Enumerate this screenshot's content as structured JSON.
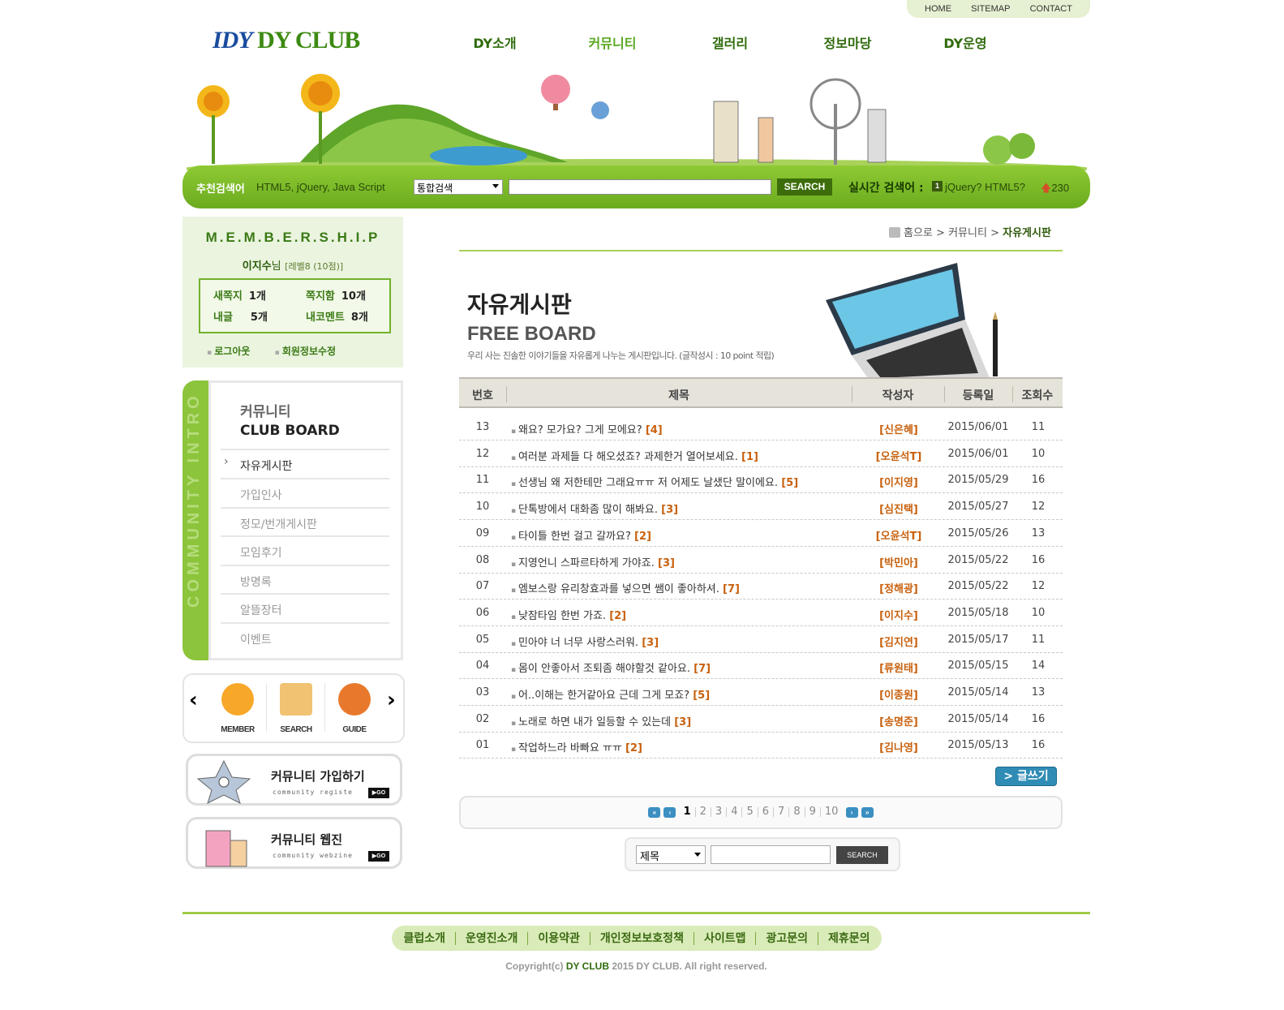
{
  "toplinks": {
    "home": "HOME",
    "sitemap": "SITEMAP",
    "contact": "CONTACT"
  },
  "logo": {
    "part1": "IDY",
    "part2": "DY CLUB"
  },
  "nav": [
    "DY소개",
    "커뮤니티",
    "갤러리",
    "정보마당",
    "DY운영"
  ],
  "search": {
    "rec_label": "추천검색어",
    "rec_words": "HTML5, jQuery, Java Script",
    "select": "통합검색",
    "button": "SEARCH",
    "rt_label": "실시간 검색어 :",
    "rt_rank": "1",
    "rt_word": "jQuery? HTML5?",
    "rt_count": "230"
  },
  "member": {
    "title": "M.E.M.B.E.R.S.H.I.P",
    "name": "이지수",
    "suffix": "님",
    "level": "[레벨8 (10점)]",
    "stats": {
      "new_note_label": "새쪽지",
      "new_note": "1개",
      "note_box_label": "쪽지함",
      "note_box": "10개",
      "my_post_label": "내글",
      "my_post": "5개",
      "my_comment_label": "내코멘트",
      "my_comment": "8개"
    },
    "logout": "로그아웃",
    "edit": "회원정보수정"
  },
  "side": {
    "vertical": "COMMUNITY INTRO",
    "title1": "커뮤니티",
    "title2": "CLUB BOARD",
    "items": [
      "자유게시판",
      "가입인사",
      "정모/번개게시판",
      "모임후기",
      "방명록",
      "알뜰장터",
      "이벤트"
    ]
  },
  "quick": {
    "member": "MEMBER",
    "search": "SEARCH",
    "guide": "GUIDE",
    "prev": "‹",
    "next": "›"
  },
  "banner1": {
    "title": "커뮤니티 가입하기",
    "sub": "community registe",
    "go": "▶GO"
  },
  "banner2": {
    "title": "커뮤니티 웹진",
    "sub": "community webzine",
    "go": "▶GO"
  },
  "breadcrumb": {
    "home": "홈으로",
    "sep1": ">",
    "mid": "커뮤니티",
    "sep2": ">",
    "current": "자유게시판"
  },
  "board": {
    "title_kr": "자유게시판",
    "title_en": "FREE BOARD",
    "desc": "우리 사는 진솔한 이야기들을 자유롭게 나누는 게시판입니다. (글작성시 : 10 point 적립)",
    "headers": {
      "no": "번호",
      "title": "제목",
      "author": "작성자",
      "date": "등록일",
      "hits": "조회수"
    },
    "rows": [
      {
        "no": "13",
        "title": "왜요? 모가요? 그게 모에요?",
        "cnt": "[4]",
        "author": "[신은혜]",
        "date": "2015/06/01",
        "hits": "11"
      },
      {
        "no": "12",
        "title": "여러분 과제들 다 해오셨죠? 과제한거 열어보세요.",
        "cnt": "[1]",
        "author": "[오윤석T]",
        "date": "2015/06/01",
        "hits": "10"
      },
      {
        "no": "11",
        "title": "선생님 왜 저한테만 그래요ㅠㅠ 저 어제도 날샜단 말이에요.",
        "cnt": "[5]",
        "author": "[이지영]",
        "date": "2015/05/29",
        "hits": "16"
      },
      {
        "no": "10",
        "title": "단톡방에서 대화좀 많이 해봐요.",
        "cnt": "[3]",
        "author": "[심진택]",
        "date": "2015/05/27",
        "hits": "12"
      },
      {
        "no": "09",
        "title": "타이틀 한번 걸고 갈까요?",
        "cnt": "[2]",
        "author": "[오윤석T]",
        "date": "2015/05/26",
        "hits": "13"
      },
      {
        "no": "08",
        "title": "지영언니 스파르타하게 가야죠.",
        "cnt": "[3]",
        "author": "[박민아]",
        "date": "2015/05/22",
        "hits": "16"
      },
      {
        "no": "07",
        "title": "엠보스랑 유리창효과를 넣으면 쌤이 좋아하셔.",
        "cnt": "[7]",
        "author": "[정해광]",
        "date": "2015/05/22",
        "hits": "12"
      },
      {
        "no": "06",
        "title": "낮잠타임 한번 가죠.",
        "cnt": "[2]",
        "author": "[이지수]",
        "date": "2015/05/18",
        "hits": "10"
      },
      {
        "no": "05",
        "title": "민아야 너 너무 사랑스러워.",
        "cnt": "[3]",
        "author": "[김지연]",
        "date": "2015/05/17",
        "hits": "11"
      },
      {
        "no": "04",
        "title": "몸이 안좋아서 조퇴좀 해야할것 같아요.",
        "cnt": "[7]",
        "author": "[류원태]",
        "date": "2015/05/15",
        "hits": "14"
      },
      {
        "no": "03",
        "title": "어..이해는 한거같아요 근데 그게 모죠?",
        "cnt": "[5]",
        "author": "[이종원]",
        "date": "2015/05/14",
        "hits": "13"
      },
      {
        "no": "02",
        "title": "노래로 하면 내가 일등할 수 있는데",
        "cnt": "[3]",
        "author": "[송명준]",
        "date": "2015/05/14",
        "hits": "16"
      },
      {
        "no": "01",
        "title": "작업하느라 바빠요 ㅠㅠ",
        "cnt": "[2]",
        "author": "[김나영]",
        "date": "2015/05/13",
        "hits": "16"
      }
    ],
    "write": "> 글쓰기"
  },
  "pager": {
    "first": "«",
    "prev": "‹",
    "next": "›",
    "last": "»",
    "pages": [
      "1",
      "2",
      "3",
      "4",
      "5",
      "6",
      "7",
      "8",
      "9",
      "10"
    ],
    "current": "1"
  },
  "bsearch": {
    "select": "제목",
    "button": "SEARCH"
  },
  "footer": {
    "links": [
      "클럽소개",
      "운영진소개",
      "이용약관",
      "개인정보보호정책",
      "사이트맵",
      "광고문의",
      "제휴문의"
    ],
    "copy_pre": "Copyright(c)",
    "copy_brand": "DY CLUB",
    "copy_post": "2015 DY CLUB. All right reserved."
  },
  "colors": {
    "green": "#7cbb2b",
    "dark_green": "#2f6b0c",
    "accent_orange": "#c8610e",
    "blue_button": "#2f8cb5"
  }
}
